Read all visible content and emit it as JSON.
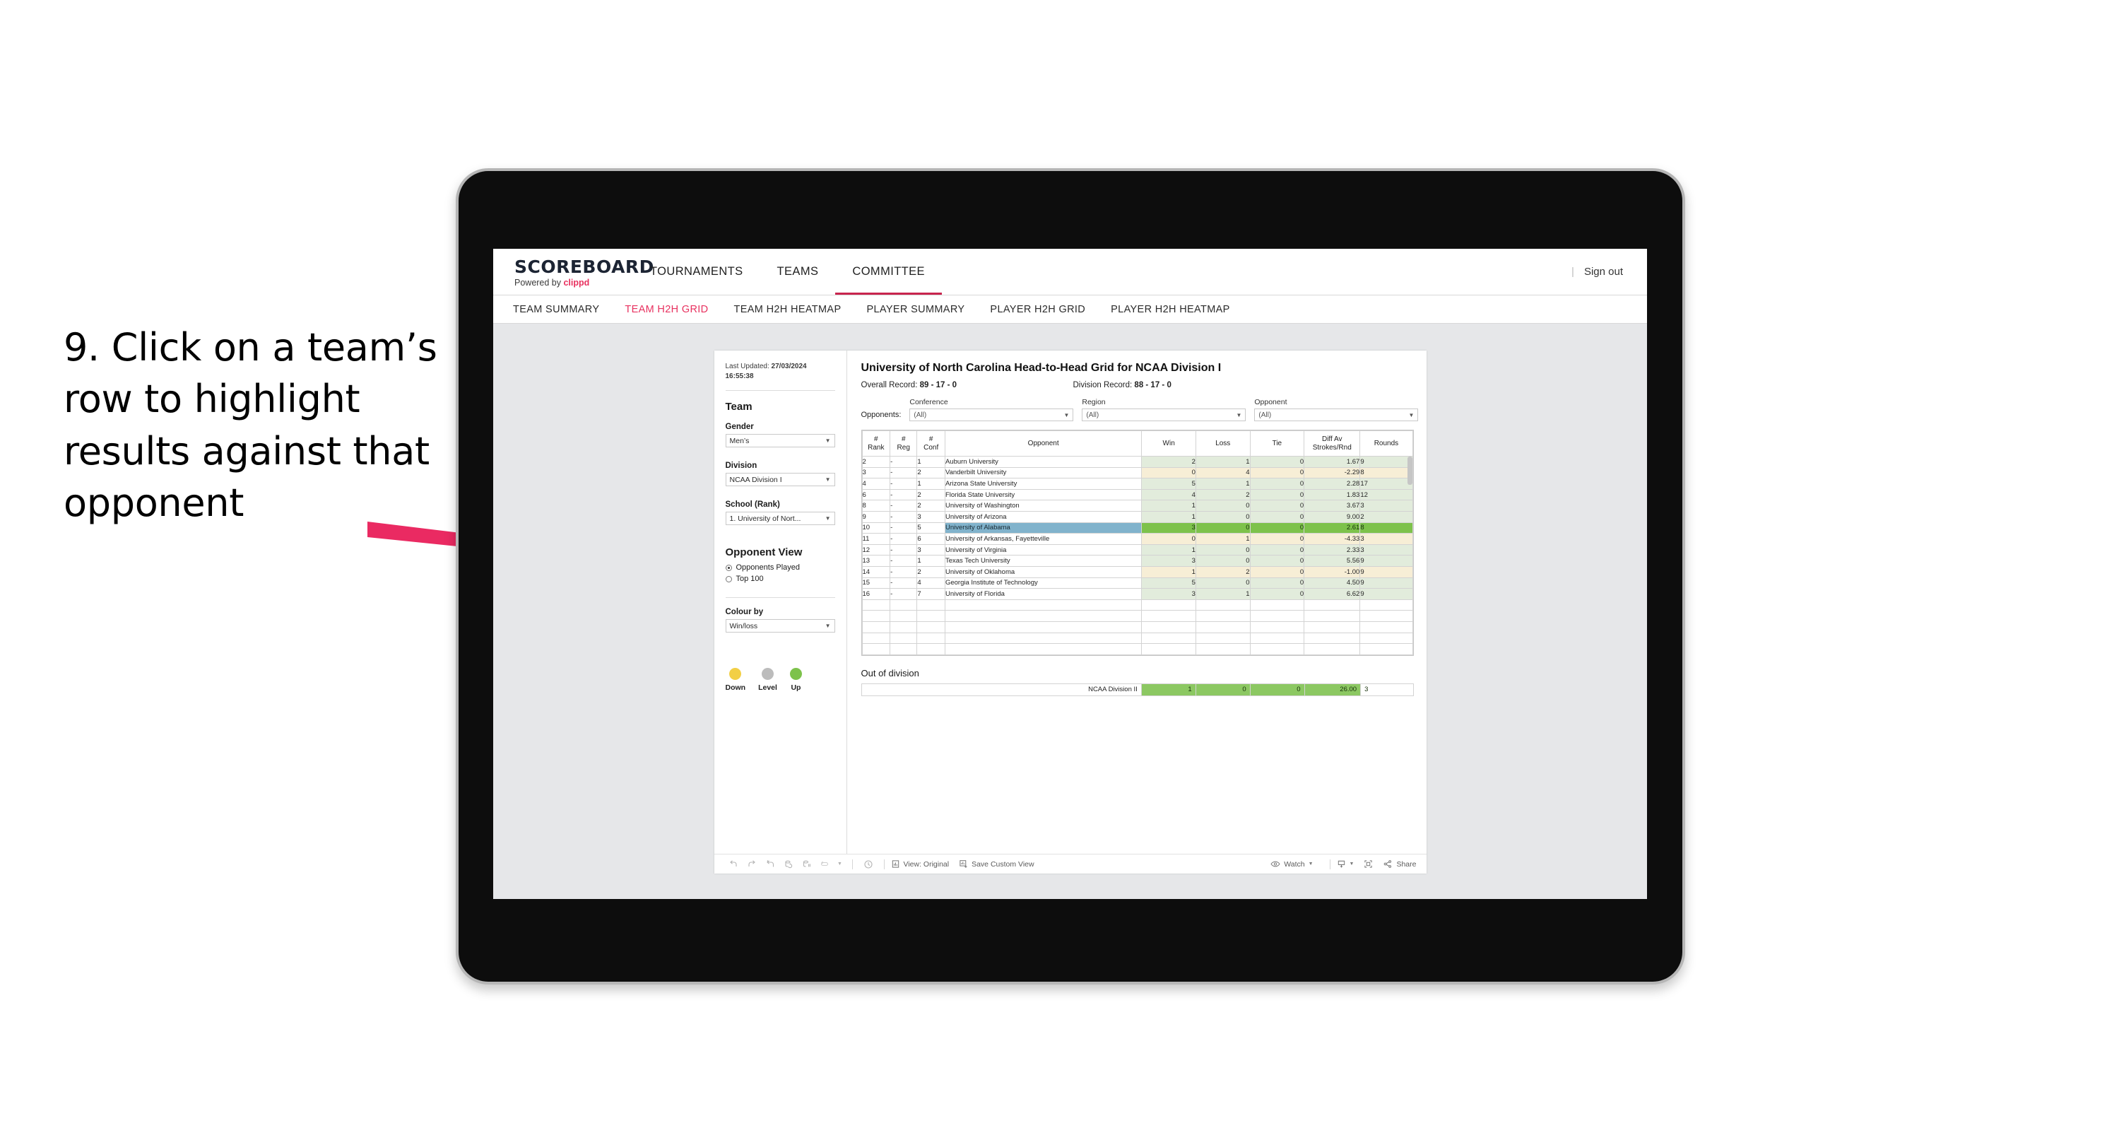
{
  "annotation": {
    "text": "9. Click on a team’s row to highlight results against that opponent",
    "arrow_color": "#ea2a62"
  },
  "topnav": {
    "brand_title": "SCOREBOARD",
    "brand_sub_prefix": "Powered by ",
    "brand_sub_name": "clippd",
    "items": [
      {
        "label": "TOURNAMENTS",
        "active": false
      },
      {
        "label": "TEAMS",
        "active": false
      },
      {
        "label": "COMMITTEE",
        "active": true
      }
    ],
    "divider": "|",
    "signout": "Sign out"
  },
  "subnav": {
    "items": [
      {
        "label": "TEAM SUMMARY",
        "active": false
      },
      {
        "label": "TEAM H2H GRID",
        "active": true
      },
      {
        "label": "TEAM H2H HEATMAP",
        "active": false
      },
      {
        "label": "PLAYER SUMMARY",
        "active": false
      },
      {
        "label": "PLAYER H2H GRID",
        "active": false
      },
      {
        "label": "PLAYER H2H HEATMAP",
        "active": false
      }
    ]
  },
  "sidebar": {
    "last_updated_label": "Last Updated: ",
    "last_updated_value": "27/03/2024 16:55:38",
    "team_heading": "Team",
    "gender_label": "Gender",
    "gender_value": "Men’s",
    "division_label": "Division",
    "division_value": "NCAA Division I",
    "school_label": "School (Rank)",
    "school_value": "1. University of Nort...",
    "opponent_view_heading": "Opponent View",
    "opponent_view_options": [
      {
        "label": "Opponents Played",
        "selected": true
      },
      {
        "label": "Top 100",
        "selected": false
      }
    ],
    "colour_by_label": "Colour by",
    "colour_by_value": "Win/loss",
    "legend": [
      {
        "label": "Down",
        "color": "#f2cf45"
      },
      {
        "label": "Level",
        "color": "#bcbcbc"
      },
      {
        "label": "Up",
        "color": "#7dc24b"
      }
    ]
  },
  "viz": {
    "title": "University of North Carolina Head-to-Head Grid for NCAA Division I",
    "overall_record_label": "Overall Record: ",
    "overall_record_value": "89 - 17 - 0",
    "division_record_label": "Division Record: ",
    "division_record_value": "88 - 17 - 0",
    "opponents_label": "Opponents:",
    "filters": [
      {
        "label": "Conference",
        "value": "(All)"
      },
      {
        "label": "Region",
        "value": "(All)"
      },
      {
        "label": "Opponent",
        "value": "(All)"
      }
    ],
    "columns": [
      "# Rank",
      "# Reg",
      "# Conf",
      "Opponent",
      "Win",
      "Loss",
      "Tie",
      "Diff Av Strokes/Rnd",
      "Rounds"
    ],
    "rows": [
      {
        "rank": "2",
        "reg": "-",
        "conf": "1",
        "opponent": "Auburn University",
        "win": "2",
        "loss": "1",
        "tie": "0",
        "diff": "1.67",
        "rounds": "9",
        "tone": "green",
        "highlighted": false
      },
      {
        "rank": "3",
        "reg": "-",
        "conf": "2",
        "opponent": "Vanderbilt University",
        "win": "0",
        "loss": "4",
        "tie": "0",
        "diff": "-2.29",
        "rounds": "8",
        "tone": "yellow",
        "highlighted": false
      },
      {
        "rank": "4",
        "reg": "-",
        "conf": "1",
        "opponent": "Arizona State University",
        "win": "5",
        "loss": "1",
        "tie": "0",
        "diff": "2.28",
        "rounds": "17",
        "tone": "green",
        "highlighted": false
      },
      {
        "rank": "6",
        "reg": "-",
        "conf": "2",
        "opponent": "Florida State University",
        "win": "4",
        "loss": "2",
        "tie": "0",
        "diff": "1.83",
        "rounds": "12",
        "tone": "green",
        "highlighted": false
      },
      {
        "rank": "8",
        "reg": "-",
        "conf": "2",
        "opponent": "University of Washington",
        "win": "1",
        "loss": "0",
        "tie": "0",
        "diff": "3.67",
        "rounds": "3",
        "tone": "green",
        "highlighted": false
      },
      {
        "rank": "9",
        "reg": "-",
        "conf": "3",
        "opponent": "University of Arizona",
        "win": "1",
        "loss": "0",
        "tie": "0",
        "diff": "9.00",
        "rounds": "2",
        "tone": "green",
        "highlighted": false
      },
      {
        "rank": "10",
        "reg": "-",
        "conf": "5",
        "opponent": "University of Alabama",
        "win": "3",
        "loss": "0",
        "tie": "0",
        "diff": "2.61",
        "rounds": "8",
        "tone": "selected",
        "highlighted": true
      },
      {
        "rank": "11",
        "reg": "-",
        "conf": "6",
        "opponent": "University of Arkansas, Fayetteville",
        "win": "0",
        "loss": "1",
        "tie": "0",
        "diff": "-4.33",
        "rounds": "3",
        "tone": "yellow",
        "highlighted": false
      },
      {
        "rank": "12",
        "reg": "-",
        "conf": "3",
        "opponent": "University of Virginia",
        "win": "1",
        "loss": "0",
        "tie": "0",
        "diff": "2.33",
        "rounds": "3",
        "tone": "green",
        "highlighted": false
      },
      {
        "rank": "13",
        "reg": "-",
        "conf": "1",
        "opponent": "Texas Tech University",
        "win": "3",
        "loss": "0",
        "tie": "0",
        "diff": "5.56",
        "rounds": "9",
        "tone": "green",
        "highlighted": false
      },
      {
        "rank": "14",
        "reg": "-",
        "conf": "2",
        "opponent": "University of Oklahoma",
        "win": "1",
        "loss": "2",
        "tie": "0",
        "diff": "-1.00",
        "rounds": "9",
        "tone": "yellow",
        "highlighted": false
      },
      {
        "rank": "15",
        "reg": "-",
        "conf": "4",
        "opponent": "Georgia Institute of Technology",
        "win": "5",
        "loss": "0",
        "tie": "0",
        "diff": "4.50",
        "rounds": "9",
        "tone": "green",
        "highlighted": false
      },
      {
        "rank": "16",
        "reg": "-",
        "conf": "7",
        "opponent": "University of Florida",
        "win": "3",
        "loss": "1",
        "tie": "0",
        "diff": "6.62",
        "rounds": "9",
        "tone": "green",
        "highlighted": false
      }
    ],
    "out_of_division_title": "Out of division",
    "out_of_division_row": {
      "label": "NCAA Division II",
      "win": "1",
      "loss": "0",
      "tie": "0",
      "diff": "26.00",
      "rounds": "3"
    }
  },
  "toolbar": {
    "view_label": "View: Original",
    "save_label": "Save Custom View",
    "watch_label": "Watch",
    "share_label": "Share"
  }
}
